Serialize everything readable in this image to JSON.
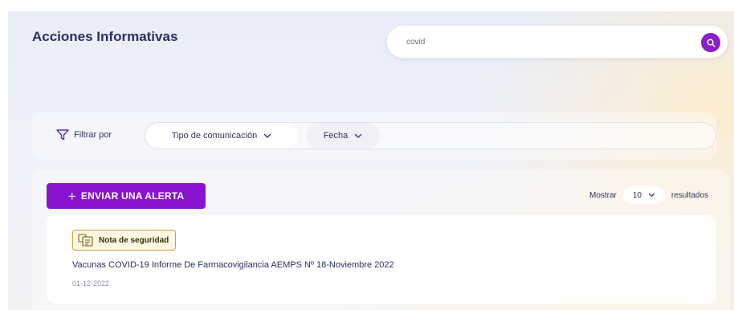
{
  "header": {
    "title": "Acciones Informativas"
  },
  "search": {
    "value": "covid",
    "button_icon": "search-icon"
  },
  "filters": {
    "label": "Filtrar por",
    "icon": "filter-icon",
    "options": [
      "Tipo de comunicación",
      "Fecha"
    ]
  },
  "toolbar": {
    "alert_button": "ENVIAR UNA ALERTA",
    "show_prefix": "Mostrar",
    "show_value": "10",
    "show_suffix": "resultados"
  },
  "results": [
    {
      "badge": "Nota de seguridad",
      "badge_icon": "document-note-icon",
      "title": "Vacunas COVID-19 Informe De Farmacovigilancia AEMPS Nº 18-Noviembre 2022",
      "date": "01-12-2022"
    }
  ],
  "colors": {
    "accent": "#8a13cf",
    "title": "#2a2f63",
    "badge_border": "#c9a42f",
    "badge_bg": "#fdf8e4"
  }
}
